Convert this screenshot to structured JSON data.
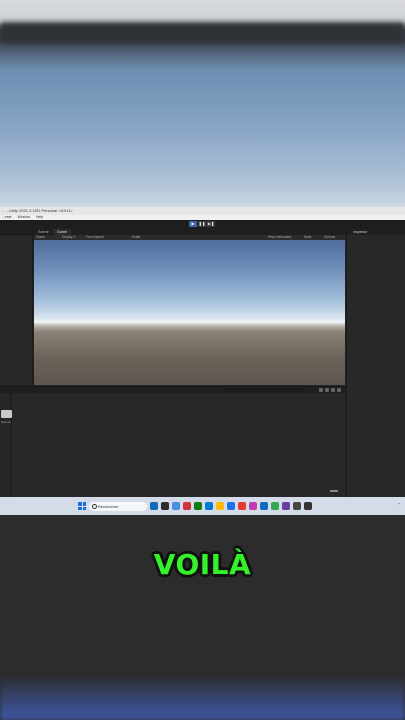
{
  "unity": {
    "window_title": "... - Unity 2021.3.19f1 Personal <DX11>",
    "menu": [
      "...eset",
      "Window",
      "Help"
    ],
    "tabs": [
      "Scene",
      "Game"
    ],
    "game_bar": {
      "display": "Game",
      "display_num": "Display 1",
      "aspect": "Free Aspect",
      "scale": "Scale",
      "play_mode": "Play Unfocused",
      "stats": "Stats",
      "gizmos": "Gizmos"
    },
    "inspector_tab": "Inspector",
    "project_folder_label": "Scenes"
  },
  "taskbar": {
    "search_placeholder": "Rechercher",
    "icon_colors": [
      "#0f6cbd",
      "#2c2c2c",
      "#4c8de0",
      "#d13438",
      "#107c10",
      "#0078d4",
      "#ffb900",
      "#1a73e8",
      "#e33b2e",
      "#c239b3",
      "#0f6cbd",
      "#34a853",
      "#6b3fa0",
      "#444",
      "#333"
    ]
  },
  "caption": "VOILÀ",
  "colors": {
    "caption": "#34f22a",
    "play_active": "#3b67a8",
    "start": "#1e6fd8"
  }
}
